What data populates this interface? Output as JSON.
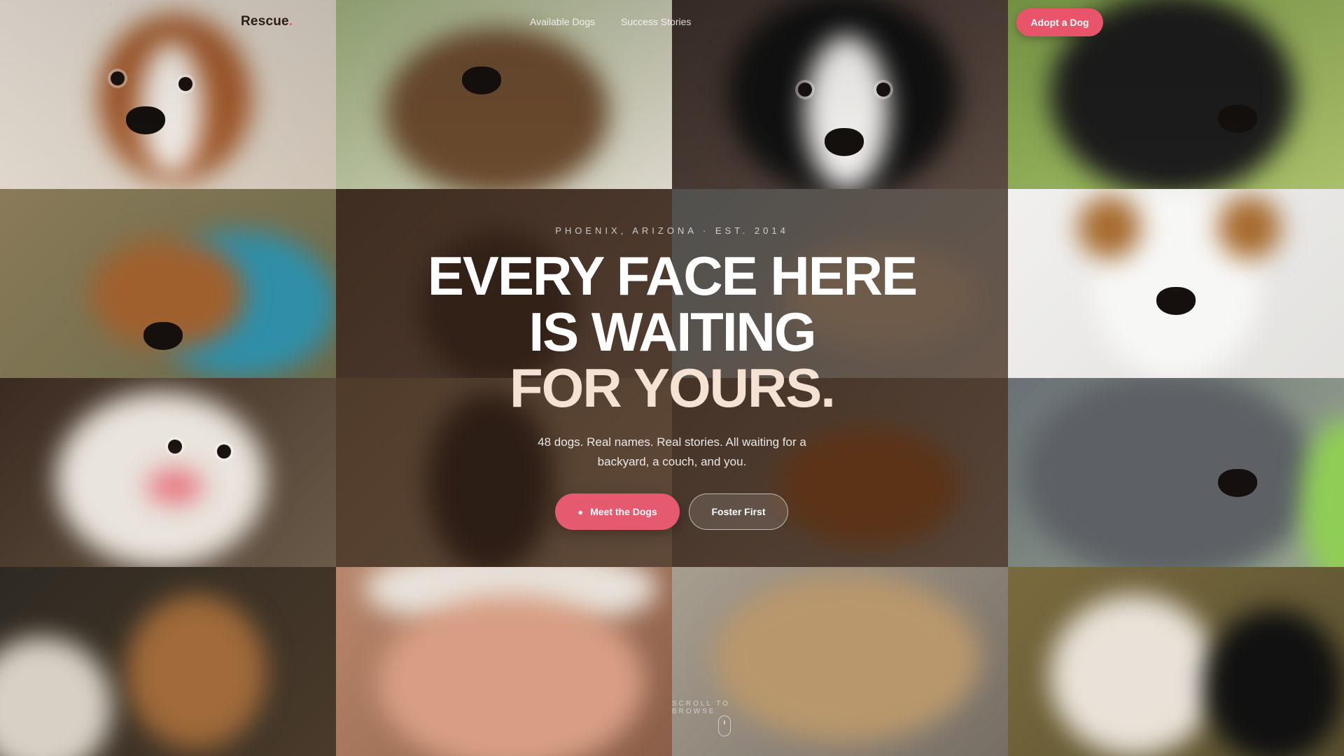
{
  "nav": {
    "brand": "Rescue",
    "brand_dot": ".",
    "links": [
      "Available Dogs",
      "Success Stories",
      ""
    ],
    "cta_label": "Adopt a Dog"
  },
  "hero": {
    "eyebrow": "PHOENIX, ARIZONA · EST. 2014",
    "headline_line1": "EVERY FACE HERE",
    "headline_line2": "IS WAITING",
    "headline_line3": "FOR YOURS.",
    "subtext": "48 dogs. Real names. Real stories. All waiting for a backyard, a couch, and you.",
    "primary_button": "Meet the Dogs",
    "primary_icon": "paw-icon",
    "secondary_button": "Foster First"
  },
  "scroll_hint": "SCROLL TO BROWSE",
  "mosaic": {
    "photos": [
      "cavalier-spaniel-puppy",
      "brown-dog-yawning",
      "border-collie",
      "black-labrador",
      "dachshund-on-blanket",
      "dog-behind-fence",
      "dog-on-bed",
      "jack-russell-terrier",
      "white-spitz",
      "german-shepherd-puppy",
      "dogs-playing",
      "grey-labrador-closeup",
      "yorkshire-terrier",
      "older-man-portrait",
      "sleeping-golden-dog",
      "two-dogs-cuddling"
    ]
  },
  "colors": {
    "accent": "#e8556b",
    "overlay": "#2d1c14",
    "headline_accent": "#f6e2d2"
  }
}
